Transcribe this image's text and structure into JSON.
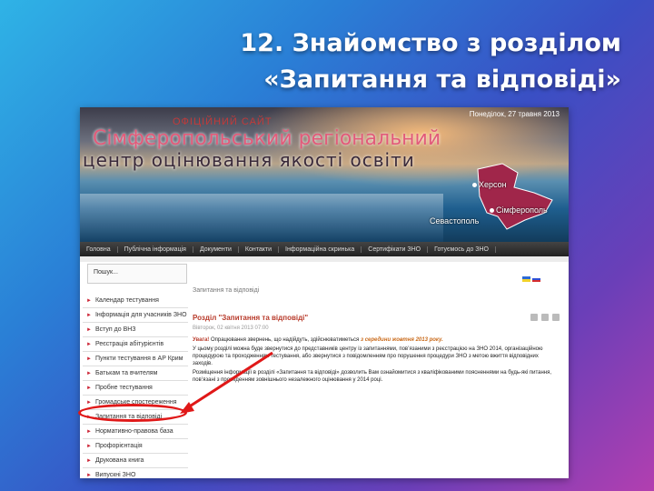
{
  "slide": {
    "title_line1": "12. Знайомство з розділом",
    "title_line2": "«Запитання та відповіді»"
  },
  "site": {
    "date": "Понеділок, 27 травня 2013",
    "official": "ОФІЦІЙНИЙ САЙТ",
    "title1": "Сімферопольський регіональний",
    "title2": "центр оцінювання якості освіти",
    "cities": [
      "Херсон",
      "Сімферополь",
      "Севастополь"
    ],
    "nav": [
      "Головна",
      "Публічна інформація",
      "Документи",
      "Контакти",
      "Інформаційна скринька",
      "Сертифікати ЗНО",
      "Готуємось до ЗНО"
    ],
    "search_placeholder": "Пошук...",
    "sidebar": [
      "Календар тестування",
      "Інформація для учасників ЗНО",
      "Вступ до ВНЗ",
      "Реєстрація абітурієнтів",
      "Пункти тестування в АР Крим",
      "Батькам та вчителям",
      "Пробне тестування",
      "Громадське спостереження",
      "Запитання та відповіді",
      "Нормативно-правова база",
      "Профорієнтація",
      "Друкована книга",
      "Випускні ЗНО"
    ],
    "content": {
      "breadcrumb": "Запитання та відповіді",
      "article_title": "Розділ \"Запитання та відповіді\"",
      "article_date": "Вівторок, 02 квітня 2013 07:00",
      "p1_lead": "Увага!",
      "p1_text": "Опрацювання звернень, що надійдуть, здійснюватиметься",
      "p1_emph": "з середини жовтня 2013 року.",
      "p2": "У цьому розділі можна буде звернутися до представників центру із запитаннями, пов’язаними з реєстрацією на ЗНО 2014, організаційною процедурою та проходженням тестування, або звернутися з повідомленням про порушення процедури ЗНО з метою вжиття відповідних заходів.",
      "p3": "Розміщення інформації в розділі «Запитання та відповіді» дозволить Вам ознайомитися з кваліфікованими поясненнями на будь-які питання, пов’язані з проведенням зовнішнього незалежного оцінювання у 2014 році."
    }
  },
  "colors": {
    "highlight": "#e01818",
    "accent": "#b83a2a"
  }
}
